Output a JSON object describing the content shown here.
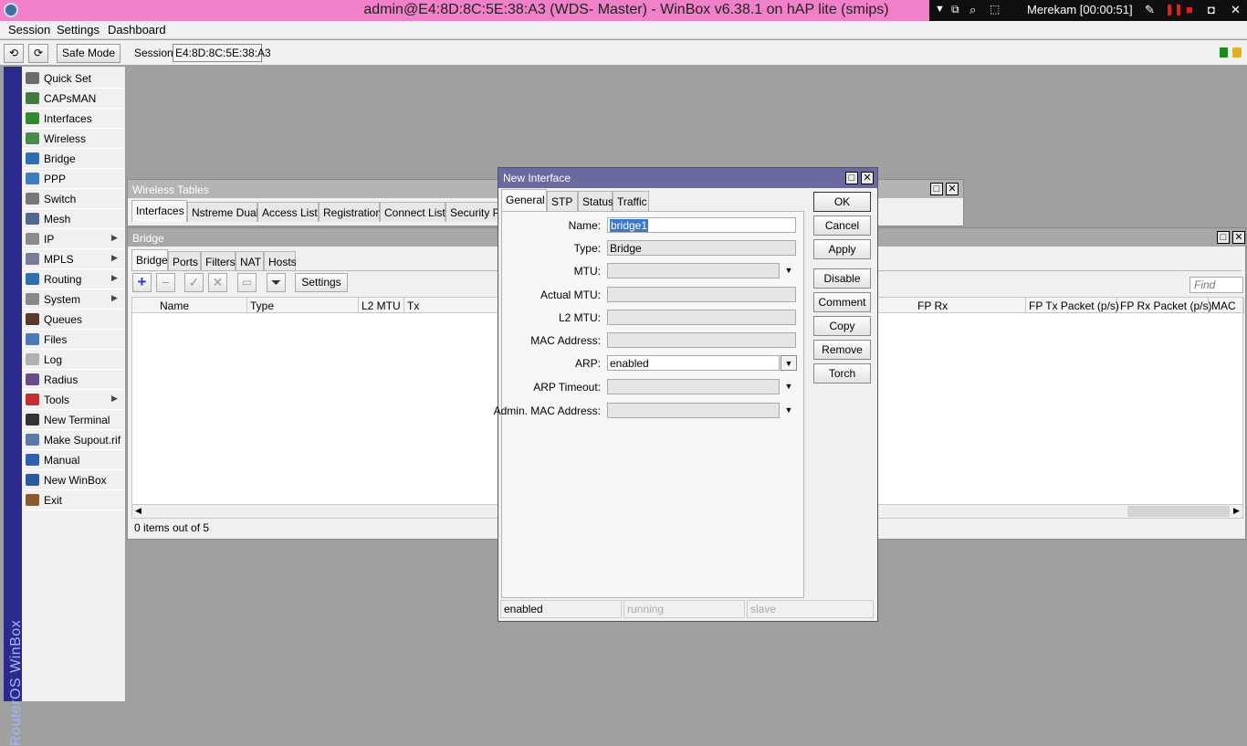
{
  "titlebar": {
    "title": "admin@E4:8D:8C:5E:38:A3 (WDS- Master) - WinBox v6.38.1 on hAP lite (smips)"
  },
  "recorder": {
    "label": "Merekam [00:00:51]"
  },
  "menu": {
    "session": "Session",
    "settings": "Settings",
    "dashboard": "Dashboard"
  },
  "toolbar": {
    "undo": "⟲",
    "redo": "⟳",
    "safe_mode": "Safe Mode",
    "session_label": "Session:",
    "session_value": "E4:8D:8C:5E:38:A3"
  },
  "sidebar": {
    "brand": "RouterOS WinBox",
    "items": [
      {
        "label": "Quick Set",
        "icon": "quick-set-icon",
        "color": "#6a6a6a",
        "arrow": ""
      },
      {
        "label": "CAPsMAN",
        "icon": "capsman-icon",
        "color": "#3f7d3f",
        "arrow": ""
      },
      {
        "label": "Interfaces",
        "icon": "interfaces-icon",
        "color": "#2f8a2f",
        "arrow": ""
      },
      {
        "label": "Wireless",
        "icon": "wireless-icon",
        "color": "#4a8a4a",
        "arrow": ""
      },
      {
        "label": "Bridge",
        "icon": "bridge-icon",
        "color": "#2f6fb0",
        "arrow": ""
      },
      {
        "label": "PPP",
        "icon": "ppp-icon",
        "color": "#3c7cc0",
        "arrow": ""
      },
      {
        "label": "Switch",
        "icon": "switch-icon",
        "color": "#777777",
        "arrow": ""
      },
      {
        "label": "Mesh",
        "icon": "mesh-icon",
        "color": "#4d6a8a",
        "arrow": ""
      },
      {
        "label": "IP",
        "icon": "ip-icon",
        "color": "#8a8a8a",
        "arrow": "▶"
      },
      {
        "label": "MPLS",
        "icon": "mpls-icon",
        "color": "#7a7a9a",
        "arrow": "▶"
      },
      {
        "label": "Routing",
        "icon": "routing-icon",
        "color": "#2f6fb0",
        "arrow": "▶"
      },
      {
        "label": "System",
        "icon": "system-gear-icon",
        "color": "#888888",
        "arrow": "▶"
      },
      {
        "label": "Queues",
        "icon": "queues-icon",
        "color": "#5a3a2a",
        "arrow": ""
      },
      {
        "label": "Files",
        "icon": "files-folder-icon",
        "color": "#4a7ab8",
        "arrow": ""
      },
      {
        "label": "Log",
        "icon": "log-icon",
        "color": "#b0b0b0",
        "arrow": ""
      },
      {
        "label": "Radius",
        "icon": "radius-icon",
        "color": "#6a4a8a",
        "arrow": ""
      },
      {
        "label": "Tools",
        "icon": "tools-icon",
        "color": "#c03030",
        "arrow": "▶"
      },
      {
        "label": "New Terminal",
        "icon": "terminal-icon",
        "color": "#333333",
        "arrow": ""
      },
      {
        "label": "Make Supout.rif",
        "icon": "supout-icon",
        "color": "#5a7aaa",
        "arrow": ""
      },
      {
        "label": "Manual",
        "icon": "manual-help-icon",
        "color": "#2f5fb0",
        "arrow": ""
      },
      {
        "label": "New WinBox",
        "icon": "new-winbox-icon",
        "color": "#2a5aa0",
        "arrow": ""
      },
      {
        "label": "Exit",
        "icon": "exit-icon",
        "color": "#8a5a2a",
        "arrow": ""
      }
    ]
  },
  "wireless_tables": {
    "title": "Wireless Tables",
    "tabs": [
      "Interfaces",
      "Nstreme Dual",
      "Access List",
      "Registration",
      "Connect List",
      "Security Pro"
    ]
  },
  "bridge_window": {
    "title": "Bridge",
    "tabs": [
      "Bridge",
      "Ports",
      "Filters",
      "NAT",
      "Hosts"
    ],
    "settings_button": "Settings",
    "find_placeholder": "Find",
    "columns": [
      "Name",
      "Type",
      "L2 MTU",
      "Tx",
      "FP Rx",
      "FP Tx Packet (p/s)",
      "FP Rx Packet (p/s)",
      "MAC"
    ],
    "status": "0 items out of 5"
  },
  "dialog": {
    "title": "New Interface",
    "tabs": [
      "General",
      "STP",
      "Status",
      "Traffic"
    ],
    "fields": {
      "name_label": "Name:",
      "name_value": "bridge1",
      "type_label": "Type:",
      "type_value": "Bridge",
      "mtu_label": "MTU:",
      "actual_mtu_label": "Actual MTU:",
      "l2mtu_label": "L2 MTU:",
      "mac_label": "MAC Address:",
      "arp_label": "ARP:",
      "arp_value": "enabled",
      "arp_timeout_label": "ARP Timeout:",
      "admin_mac_label": "Admin. MAC Address:"
    },
    "buttons": {
      "ok": "OK",
      "cancel": "Cancel",
      "apply": "Apply",
      "disable": "Disable",
      "comment": "Comment",
      "copy": "Copy",
      "remove": "Remove",
      "torch": "Torch"
    },
    "status": {
      "enabled": "enabled",
      "running": "running",
      "slave": "slave"
    }
  }
}
